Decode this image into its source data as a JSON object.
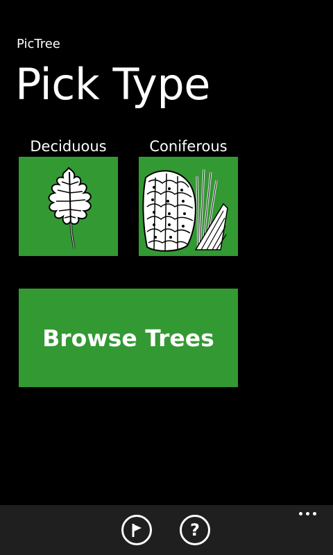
{
  "app": {
    "name": "PicTree"
  },
  "page": {
    "title": "Pick Type"
  },
  "tiles": [
    {
      "label": "Deciduous",
      "icon": "leaf-icon"
    },
    {
      "label": "Coniferous",
      "icon": "pinecone-icon"
    }
  ],
  "browse": {
    "label": "Browse Trees"
  },
  "appbar": {
    "buttons": [
      {
        "icon": "flag-icon"
      },
      {
        "icon": "help-icon",
        "glyph": "?"
      }
    ],
    "more_icon": "ellipsis-icon"
  },
  "colors": {
    "background": "#000000",
    "accent": "#339933",
    "appbar": "#1f1f1f",
    "text": "#ffffff"
  }
}
